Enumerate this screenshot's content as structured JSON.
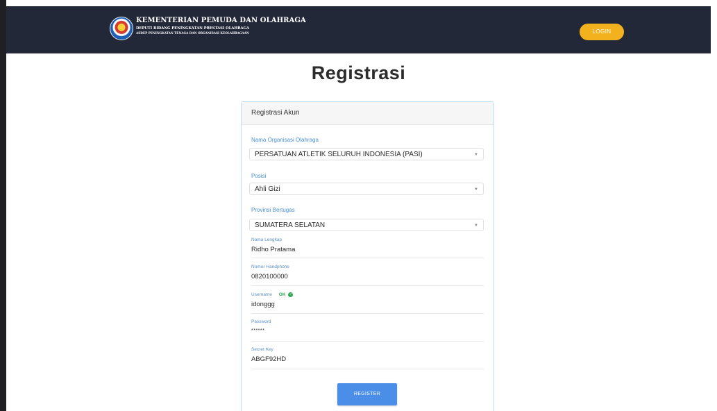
{
  "header": {
    "title": "KEMENTERIAN PEMUDA DAN OLAHRAGA",
    "subtitle_line1": "DEPUTI BIDANG PENINGKATAN PRESTASI OLAHRAGA",
    "subtitle_line2": "ASDEP PENINGKATAN TENAGA DAN ORGANISASI KEOLAHRAGAAN",
    "login_label": "LOGIN"
  },
  "page": {
    "title": "Registrasi"
  },
  "form": {
    "card_title": "Registrasi Akun",
    "organisasi": {
      "label": "Nama Organisasi Olahraga",
      "value": "PERSATUAN ATLETIK SELURUH INDONESIA (PASI)"
    },
    "posisi": {
      "label": "Posisi",
      "value": "Ahli Gizi"
    },
    "provinsi": {
      "label": "Provinsi Bertugas",
      "value": "SUMATERA SELATAN"
    },
    "nama": {
      "label": "Nama Lengkap",
      "value": "Ridho Pratama"
    },
    "handphone": {
      "label": "Nomor Handphone",
      "value": "0820100000"
    },
    "username": {
      "label": "Username",
      "status": "OK",
      "value": "idonggg"
    },
    "password": {
      "label": "Password",
      "value": "******"
    },
    "secret_key": {
      "label": "Secret Key",
      "value": "ABGF92HD"
    },
    "register_label": "REGISTER"
  },
  "colors": {
    "navbar": "#232838",
    "login_button": "#f3b11e",
    "register_button": "#4a8ee8",
    "label_blue": "#4a90d9",
    "ok_green": "#2fa84f"
  }
}
